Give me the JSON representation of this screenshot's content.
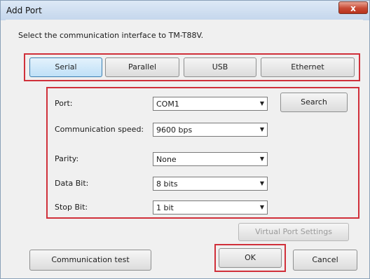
{
  "window": {
    "title": "Add Port",
    "close_glyph": "x"
  },
  "prompt": "Select the communication interface to TM-T88V.",
  "interfaces": [
    {
      "label": "Serial",
      "selected": true
    },
    {
      "label": "Parallel",
      "selected": false
    },
    {
      "label": "USB",
      "selected": false
    },
    {
      "label": "Ethernet",
      "selected": false
    }
  ],
  "settings": {
    "port": {
      "label": "Port:",
      "value": "COM1"
    },
    "speed": {
      "label": "Communication speed:",
      "value": "9600 bps"
    },
    "parity": {
      "label": "Parity:",
      "value": "None"
    },
    "data_bit": {
      "label": "Data Bit:",
      "value": "8 bits"
    },
    "stop_bit": {
      "label": "Stop Bit:",
      "value": "1 bit"
    },
    "dropdown_glyph": "▼"
  },
  "buttons": {
    "search": "Search",
    "virtual_port": "Virtual Port Settings",
    "comm_test": "Communication test",
    "ok": "OK",
    "cancel": "Cancel"
  },
  "colors": {
    "highlight": "#d0303a",
    "selected_tab": "#bfe0f7"
  }
}
